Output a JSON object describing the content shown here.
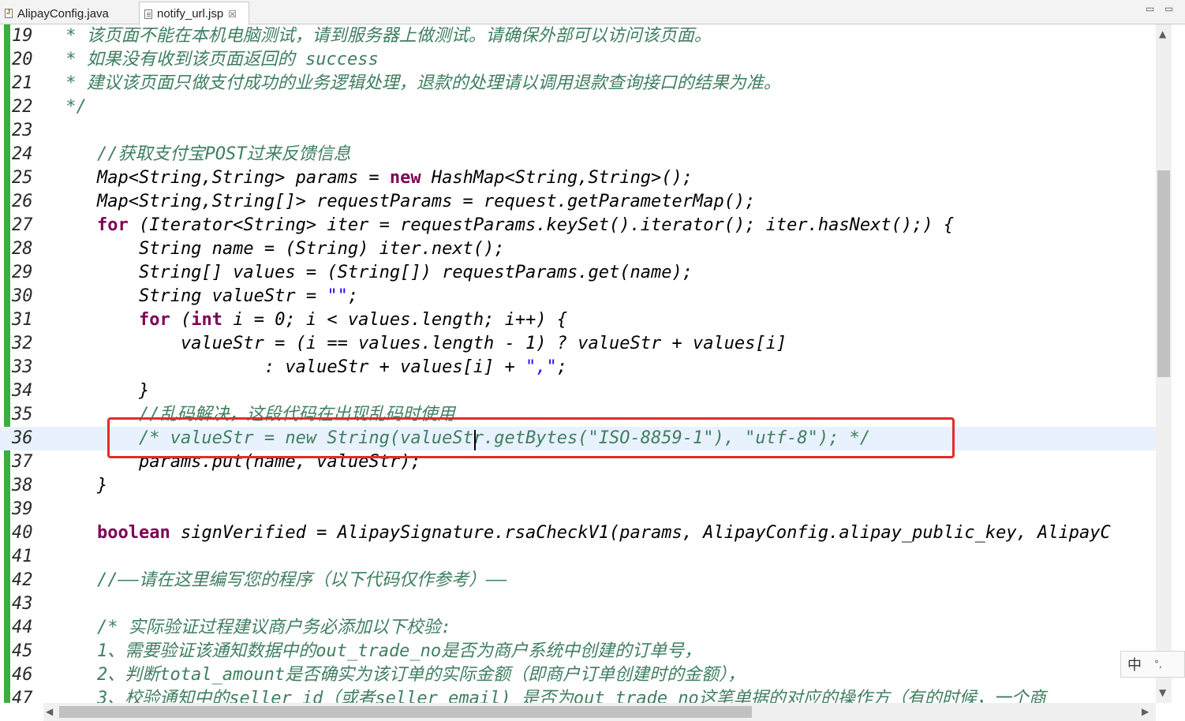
{
  "tabs": [
    {
      "label": "AlipayConfig.java",
      "active": false
    },
    {
      "label": "notify_url.jsp",
      "active": true,
      "close": "☒"
    }
  ],
  "window_controls": {
    "minimize": "▭",
    "maximize": "▭"
  },
  "lines": [
    {
      "num": "19",
      "parts": [
        {
          "t": " * 该页面不能在本机电脑测试，请到服务器上做测试。请确保外部可以访问该页面。",
          "c": "cm"
        }
      ]
    },
    {
      "num": "20",
      "parts": [
        {
          "t": " * 如果没有收到该页面返回的 success",
          "c": "cm"
        }
      ]
    },
    {
      "num": "21",
      "parts": [
        {
          "t": " * 建议该页面只做支付成功的业务逻辑处理，退款的处理请以调用退款查询接口的结果为准。",
          "c": "cm"
        }
      ]
    },
    {
      "num": "22",
      "parts": [
        {
          "t": " */",
          "c": "cm"
        }
      ]
    },
    {
      "num": "23",
      "parts": []
    },
    {
      "num": "24",
      "parts": [
        {
          "t": "    //获取支付宝POST过来反馈信息",
          "c": "cm"
        }
      ]
    },
    {
      "num": "25",
      "parts": [
        {
          "t": "    Map<String,String> params = "
        },
        {
          "t": "new",
          "c": "kw"
        },
        {
          "t": " HashMap<String,String>();"
        }
      ]
    },
    {
      "num": "26",
      "parts": [
        {
          "t": "    Map<String,String[]> requestParams = request.getParameterMap();"
        }
      ]
    },
    {
      "num": "27",
      "parts": [
        {
          "t": "    "
        },
        {
          "t": "for",
          "c": "kw"
        },
        {
          "t": " (Iterator<String> iter = requestParams.keySet().iterator(); iter.hasNext();) {"
        }
      ]
    },
    {
      "num": "28",
      "parts": [
        {
          "t": "        String name = (String) iter.next();"
        }
      ]
    },
    {
      "num": "29",
      "parts": [
        {
          "t": "        String[] values = (String[]) requestParams.get(name);"
        }
      ]
    },
    {
      "num": "30",
      "parts": [
        {
          "t": "        String valueStr = "
        },
        {
          "t": "\"\"",
          "c": "st"
        },
        {
          "t": ";"
        }
      ]
    },
    {
      "num": "31",
      "parts": [
        {
          "t": "        "
        },
        {
          "t": "for",
          "c": "kw"
        },
        {
          "t": " ("
        },
        {
          "t": "int",
          "c": "kw"
        },
        {
          "t": " i = 0; i < values.length; i++) {"
        }
      ]
    },
    {
      "num": "32",
      "parts": [
        {
          "t": "            valueStr = (i == values.length - 1) ? valueStr + values[i]"
        }
      ]
    },
    {
      "num": "33",
      "parts": [
        {
          "t": "                    : valueStr + values[i] + "
        },
        {
          "t": "\",\"",
          "c": "st"
        },
        {
          "t": ";"
        }
      ]
    },
    {
      "num": "34",
      "parts": [
        {
          "t": "        }"
        }
      ]
    },
    {
      "num": "35",
      "parts": [
        {
          "t": "        //乱码解决，这段代码在出现乱码时使用",
          "c": "cm"
        }
      ]
    },
    {
      "num": "36",
      "current": true,
      "parts": [
        {
          "t": "        /* valueStr = new String(valueStr.getBytes(\"ISO-8859-1\"), \"utf-8\"); */",
          "c": "cm"
        }
      ]
    },
    {
      "num": "37",
      "parts": [
        {
          "t": "        params.put(name, valueStr);"
        }
      ]
    },
    {
      "num": "38",
      "parts": [
        {
          "t": "    }"
        }
      ]
    },
    {
      "num": "39",
      "parts": []
    },
    {
      "num": "40",
      "parts": [
        {
          "t": "    "
        },
        {
          "t": "boolean",
          "c": "kw"
        },
        {
          "t": " signVerified = AlipaySignature.rsaCheckV1(params, AlipayConfig.alipay_public_key, AlipayC"
        }
      ]
    },
    {
      "num": "41",
      "parts": []
    },
    {
      "num": "42",
      "parts": [
        {
          "t": "    //——请在这里编写您的程序（以下代码仅作参考）——",
          "c": "cm"
        }
      ]
    },
    {
      "num": "43",
      "parts": []
    },
    {
      "num": "44",
      "parts": [
        {
          "t": "    /* 实际验证过程建议商户务必添加以下校验:",
          "c": "cm"
        }
      ]
    },
    {
      "num": "45",
      "parts": [
        {
          "t": "    1、需要验证该通知数据中的out_trade_no是否为商户系统中创建的订单号，",
          "c": "cm"
        }
      ]
    },
    {
      "num": "46",
      "parts": [
        {
          "t": "    2、判断total_amount是否确实为该订单的实际金额（即商户订单创建时的金额），",
          "c": "cm"
        }
      ]
    },
    {
      "num": "47",
      "parts": [
        {
          "t": "    3、校验通知中的seller_id（或者seller_email) 是否为out_trade_no这笔单据的对应的操作方（有的时候，一个商",
          "c": "cm"
        }
      ]
    }
  ],
  "ime": {
    "mode": "中",
    "punct": "°,"
  },
  "scroll_arrows": {
    "up": "▲",
    "down": "▼",
    "left": "◀",
    "right": "▶"
  }
}
